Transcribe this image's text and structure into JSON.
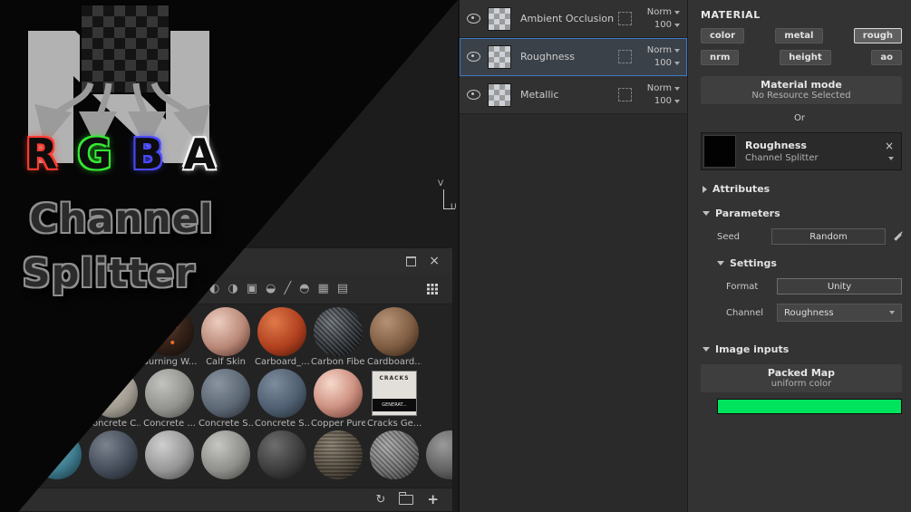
{
  "icons": {
    "close": "×",
    "refresh": "↻",
    "plus": "+"
  },
  "promo": {
    "letters": [
      {
        "char": "R",
        "color": "#ff3b30"
      },
      {
        "char": "G",
        "color": "#35e835"
      },
      {
        "char": "B",
        "color": "#4a4aff"
      },
      {
        "char": "A",
        "color": "#f5f5f5"
      }
    ],
    "title_line1": "Channel",
    "title_line2": "Splitter"
  },
  "viewport": {
    "axis_v_label": "V",
    "axis_u_label": "U"
  },
  "layers": {
    "rows": [
      {
        "name": "Ambient Occlusion",
        "blend": "Norm",
        "opacity": "100"
      },
      {
        "name": "Roughness",
        "blend": "Norm",
        "opacity": "100"
      },
      {
        "name": "Metallic",
        "blend": "Norm",
        "opacity": "100"
      }
    ]
  },
  "shelf": {
    "toolbar_icons": [
      {
        "name": "filter-materials-icon",
        "glyph": "◐"
      },
      {
        "name": "filter-smart-materials-icon",
        "glyph": "◑"
      },
      {
        "name": "filter-smart-masks-icon",
        "glyph": "▣"
      },
      {
        "name": "filter-textures-icon",
        "glyph": "◒"
      },
      {
        "name": "filter-brushes-icon",
        "glyph": "╱"
      },
      {
        "name": "filter-alphas-icon",
        "glyph": "◓"
      },
      {
        "name": "filter-procedurals-icon",
        "glyph": "▦"
      },
      {
        "name": "filter-bitmaps-icon",
        "glyph": "▤"
      }
    ],
    "rows": [
      {
        "items": [
          {
            "label": "Burning W...",
            "style": "background-image:radial-gradient(circle at 62% 38%, #e8732a 0 2px, rgba(0,0,0,0) 3px),radial-gradient(circle at 40% 62%, #c85a1f 0 2px, rgba(0,0,0,0) 3px),radial-gradient(circle at 56% 72%, #e8732a 0 1.5px, rgba(0,0,0,0) 2.5px),radial-gradient(circle at 35% 30%, #6b4a33, #3a241a 45%, #17100c 85%)"
          },
          {
            "label": "Calf Skin",
            "style": "background-image:radial-gradient(circle at 35% 30%, #eccdc0, #b98877 55%, #5e3a30 90%)"
          },
          {
            "label": "Carboard_...",
            "style": "background-image:radial-gradient(circle at 35% 30%, #e07a4a, #b0401f 55%, #5a1c0c 90%)"
          },
          {
            "label": "Carbon Fiber",
            "style": "background-image:repeating-linear-gradient(45deg, rgba(255,255,255,0.10) 0 2px, rgba(0,0,0,0.28) 2px 4px),radial-gradient(circle at 35% 30%, #70767c, #33373c 50%, #0e1012 88%)"
          },
          {
            "label": "Cardboard...",
            "style": "background-image:radial-gradient(circle at 35% 30%, #b59274, #7e5c42 55%, #3a2817 90%)"
          }
        ]
      },
      {
        "items": [
          {
            "label": "Concrete C...",
            "style": "background-image:radial-gradient(circle at 35% 30%, #cfc9bf, #a29c92 55%, #5f5a52 90%)"
          },
          {
            "label": "Concrete ...",
            "style": "background-image:radial-gradient(circle at 35% 30%, #c2c2be, #92928e 55%, #55544f 90%)"
          },
          {
            "label": "Concrete S...",
            "style": "background-image:radial-gradient(circle at 35% 30%, #8a94a0, #5c6774 55%, #2d333c 90%)"
          },
          {
            "label": "Concrete S...",
            "style": "background-image:radial-gradient(circle at 35% 30%, #7e8c9c, #4e5e70 55%, #273039 90%)"
          },
          {
            "label": "Copper Pure",
            "style": "background-image:radial-gradient(circle at 35% 30%, #f6d9cc, #cf9383 50%, #74423a 90%)"
          },
          {
            "label": "Cracks Ge...",
            "special": true,
            "line1": "CRACKS",
            "line2": "GENERAT..."
          }
        ]
      },
      {
        "items": [
          {
            "label": "",
            "style": "background-image:radial-gradient(circle at 35% 30%, #7fb7c4, #3e7c8e 55%, #1c3d48 90%)"
          },
          {
            "label": "",
            "style": "background-image:radial-gradient(circle at 35% 30%, #7a838e, #434c58 55%, #20262e 90%)"
          },
          {
            "label": "",
            "style": "background-image:radial-gradient(circle at 35% 30%, #cfcfcf, #969696 55%, #4f4f4f 90%)"
          },
          {
            "label": "",
            "style": "background-image:radial-gradient(circle at 35% 30%, #c6c6c2, #8e8e8a 55%, #4c4c48 90%)"
          },
          {
            "label": "",
            "style": "background-image:radial-gradient(circle at 35% 30%, #6e6e6e, #3c3c3c 55%, #191919 90%)"
          },
          {
            "label": "",
            "style": "background-image:repeating-linear-gradient(0deg, rgba(255,255,255,0.06) 0 2px, rgba(0,0,0,0.2) 2px 4px),radial-gradient(circle at 35% 30%, #8a8070, #50483c 55%, #241f18 90%)"
          },
          {
            "label": "",
            "style": "background-image:repeating-linear-gradient(45deg, rgba(255,255,255,0.10) 0 2px, rgba(0,0,0,0.22) 2px 4px),radial-gradient(circle at 35% 30%, #a9a9a9, #6f6f6f 55%, #333333 90%)"
          },
          {
            "label": "",
            "style": "background-image:radial-gradient(circle at 35% 30%, #9a9a9a, #606060 55%, #2c2c2c 90%)"
          }
        ]
      }
    ]
  },
  "properties": {
    "header": "MATERIAL",
    "channels": [
      "color",
      "metal",
      "rough",
      "nrm",
      "height",
      "ao"
    ],
    "active_channel": "rough",
    "material_mode": {
      "title": "Material mode",
      "subtitle": "No Resource Selected"
    },
    "or_label": "Or",
    "resource": {
      "name": "Roughness",
      "type": "Channel Splitter"
    },
    "sections": {
      "attributes": "Attributes",
      "parameters": "Parameters",
      "settings": "Settings",
      "image_inputs": "Image inputs"
    },
    "seed": {
      "label": "Seed",
      "value": "Random"
    },
    "format": {
      "label": "Format",
      "value": "Unity"
    },
    "channel": {
      "label": "Channel",
      "value": "Roughness"
    },
    "packed_map": {
      "title": "Packed Map",
      "subtitle": "uniform color"
    },
    "swatch_color": "#00e35d"
  }
}
